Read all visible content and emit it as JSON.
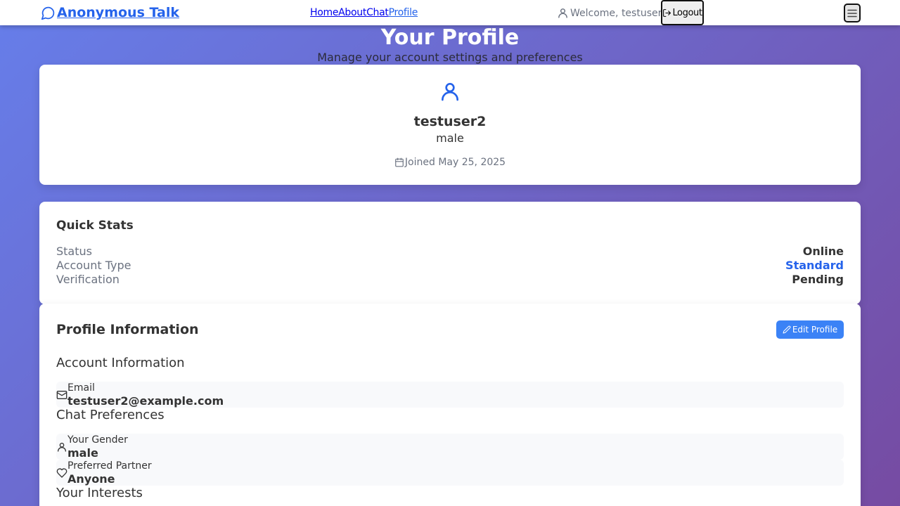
{
  "header": {
    "brand": "Anonymous Talk",
    "nav": [
      {
        "label": "Home"
      },
      {
        "label": "About"
      },
      {
        "label": "Chat"
      },
      {
        "label": "Profile",
        "active": true
      }
    ],
    "welcome": "Welcome, testuser2",
    "logout_label": "Logout",
    "icons": {
      "brand": "chat-bubble-icon",
      "user": "user-icon",
      "logout": "log-out-icon",
      "menu": "menu-icon"
    }
  },
  "page": {
    "title": "Your Profile",
    "subtitle": "Manage your account settings and preferences"
  },
  "profile_card": {
    "username": "testuser2",
    "gender": "male",
    "joined": "Joined May 25, 2025"
  },
  "quick_stats": {
    "title": "Quick Stats",
    "rows": [
      {
        "label": "Status",
        "value": "Online"
      },
      {
        "label": "Account Type",
        "value": "Standard",
        "accent": "#2563eb"
      },
      {
        "label": "Verification",
        "value": "Pending"
      }
    ]
  },
  "profile_info": {
    "title": "Profile Information",
    "edit_label": "Edit Profile",
    "account_section": "Account Information",
    "email_label": "Email",
    "email_value": "testuser2@example.com",
    "chat_section": "Chat Preferences",
    "gender_label": "Your Gender",
    "gender_value": "male",
    "partner_label": "Preferred Partner",
    "partner_value": "Anyone",
    "interests_section": "Your Interests"
  },
  "colors": {
    "accent": "#2563eb",
    "button": "#3b82f6",
    "gradient_start": "#667eea",
    "gradient_end": "#764ba2"
  }
}
